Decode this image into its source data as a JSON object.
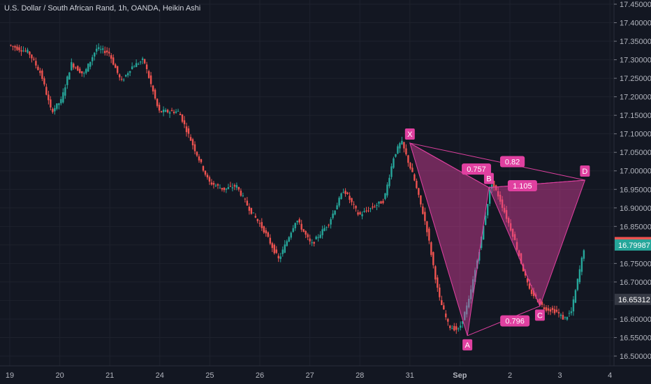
{
  "chart_data": {
    "type": "candlestick",
    "title": "U.S. Dollar / South African Rand, 1h, OANDA, Heikin Ashi",
    "ylim": [
      16.47,
      17.45
    ],
    "y_ticks": [
      "17.45000",
      "17.40000",
      "17.35000",
      "17.30000",
      "17.25000",
      "17.20000",
      "17.15000",
      "17.10000",
      "17.05000",
      "17.00000",
      "16.95000",
      "16.90000",
      "16.85000",
      "16.75000",
      "16.70000",
      "16.60000",
      "16.55000",
      "16.50000"
    ],
    "x_ticks": [
      "19",
      "20",
      "21",
      "24",
      "25",
      "26",
      "27",
      "28",
      "31",
      "Sep",
      "2",
      "3",
      "4"
    ],
    "price_labels": [
      {
        "value": 16.80642,
        "text": "16.80642",
        "color": "#ef5350"
      },
      {
        "value": 16.79987,
        "text": "16.79987",
        "color": "#26a69a"
      },
      {
        "value": 16.65312,
        "text": "16.65312",
        "color": "#363a45"
      }
    ],
    "colors": {
      "up": "#26a69a",
      "down": "#ef5350",
      "pattern": "#e040a0"
    },
    "price_path": [
      [
        0,
        17.34
      ],
      [
        0.4,
        17.32
      ],
      [
        0.65,
        17.26
      ],
      [
        0.85,
        17.16
      ],
      [
        1.05,
        17.19
      ],
      [
        1.25,
        17.29
      ],
      [
        1.5,
        17.26
      ],
      [
        1.75,
        17.33
      ],
      [
        2.0,
        17.32
      ],
      [
        2.25,
        17.24
      ],
      [
        2.45,
        17.28
      ],
      [
        2.7,
        17.3
      ],
      [
        3.0,
        17.16
      ],
      [
        3.4,
        17.16
      ],
      [
        3.65,
        17.08
      ],
      [
        4.0,
        16.97
      ],
      [
        4.3,
        16.95
      ],
      [
        4.55,
        16.96
      ],
      [
        4.8,
        16.9
      ],
      [
        5.1,
        16.84
      ],
      [
        5.4,
        16.76
      ],
      [
        5.75,
        16.87
      ],
      [
        6.05,
        16.8
      ],
      [
        6.4,
        16.86
      ],
      [
        6.7,
        16.95
      ],
      [
        7.0,
        16.88
      ],
      [
        7.25,
        16.9
      ],
      [
        7.5,
        16.92
      ],
      [
        7.7,
        17.04
      ],
      [
        7.85,
        17.08
      ],
      [
        8.1,
        16.98
      ],
      [
        8.35,
        16.85
      ],
      [
        8.6,
        16.66
      ],
      [
        8.8,
        16.58
      ],
      [
        9.0,
        16.57
      ],
      [
        9.2,
        16.65
      ],
      [
        9.4,
        16.78
      ],
      [
        9.65,
        16.97
      ],
      [
        9.8,
        16.93
      ],
      [
        10.1,
        16.82
      ],
      [
        10.4,
        16.68
      ],
      [
        10.7,
        16.63
      ],
      [
        10.95,
        16.62
      ],
      [
        11.1,
        16.6
      ],
      [
        11.25,
        16.62
      ],
      [
        11.5,
        16.79
      ]
    ],
    "harmonic_pattern": {
      "points": [
        {
          "label": "X",
          "x": 8.0,
          "y": 17.075
        },
        {
          "label": "A",
          "x": 9.15,
          "y": 16.555
        },
        {
          "label": "B",
          "x": 9.58,
          "y": 16.955
        },
        {
          "label": "C",
          "x": 10.6,
          "y": 16.635
        },
        {
          "label": "D",
          "x": 11.5,
          "y": 16.975
        }
      ],
      "ratios": [
        {
          "text": "0.757",
          "x": 9.33,
          "y": 17.005
        },
        {
          "text": "0.82",
          "x": 10.05,
          "y": 17.025
        },
        {
          "text": "1.105",
          "x": 10.25,
          "y": 16.96
        },
        {
          "text": "0.796",
          "x": 10.1,
          "y": 16.595
        }
      ]
    }
  }
}
